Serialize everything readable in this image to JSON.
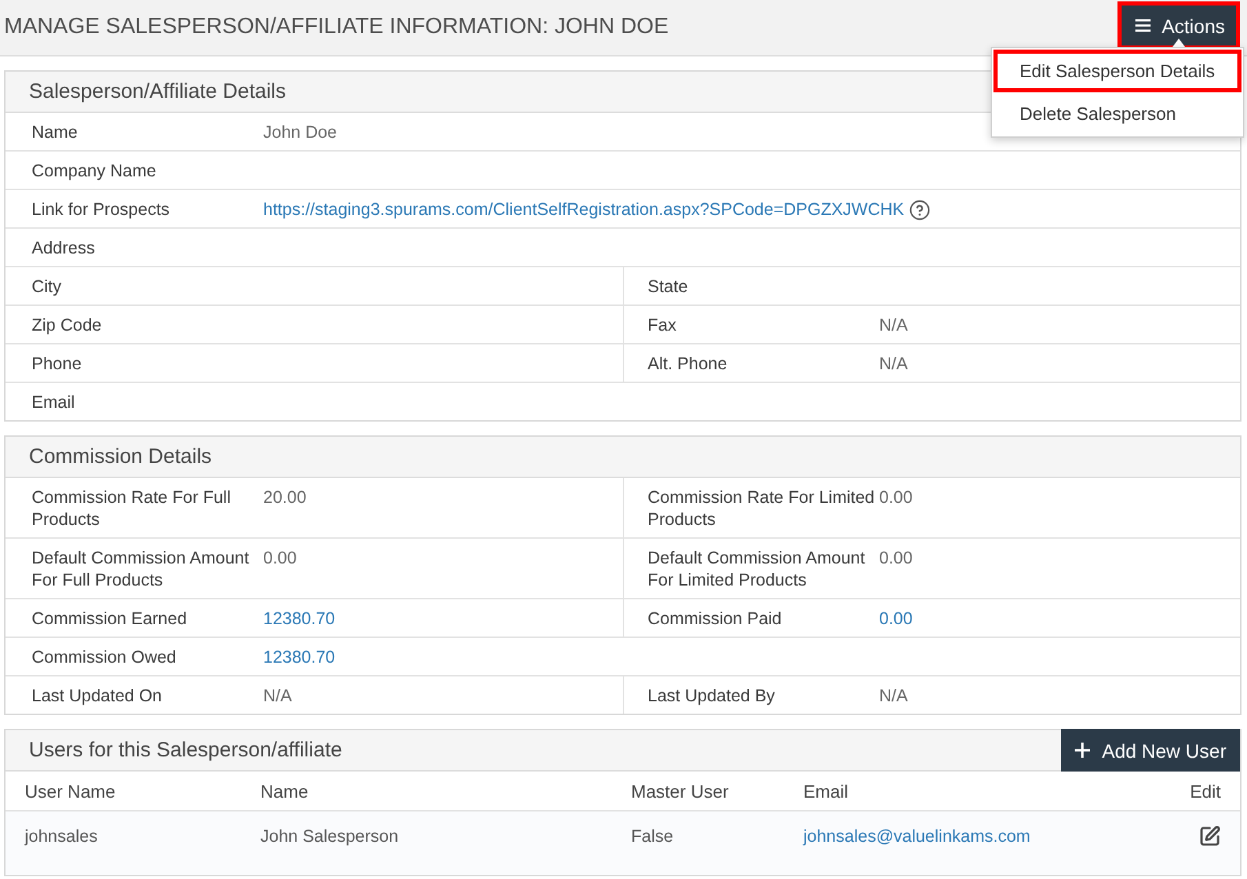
{
  "page": {
    "title": "MANAGE SALESPERSON/AFFILIATE INFORMATION: JOHN DOE"
  },
  "actions": {
    "label": "Actions",
    "highlighted": true,
    "expanded": true,
    "menu": [
      {
        "label": "Edit Salesperson Details",
        "highlighted": true
      },
      {
        "label": "Delete Salesperson",
        "highlighted": false
      }
    ]
  },
  "sections": [
    {
      "title": "Salesperson/Affiliate Details",
      "rows": [
        {
          "cells": [
            {
              "label": "Name",
              "value": "John Doe",
              "kind": "text"
            }
          ]
        },
        {
          "cells": [
            {
              "label": "Company Name"
            }
          ]
        },
        {
          "cells": [
            {
              "label": "Link for Prospects",
              "value": "https://staging3.spurams.com/ClientSelfRegistration.aspx?SPCode=DPGZXJWCHK",
              "kind": "link",
              "help": true
            }
          ]
        },
        {
          "cells": [
            {
              "label": "Address"
            }
          ]
        },
        {
          "cells": [
            {
              "label": "City"
            },
            {
              "label": "State"
            }
          ]
        },
        {
          "cells": [
            {
              "label": "Zip Code"
            },
            {
              "label": "Fax",
              "value": "N/A",
              "kind": "text"
            }
          ]
        },
        {
          "cells": [
            {
              "label": "Phone"
            },
            {
              "label": "Alt. Phone",
              "value": "N/A",
              "kind": "text"
            }
          ]
        },
        {
          "cells": [
            {
              "label": "Email"
            }
          ]
        }
      ]
    },
    {
      "title": "Commission Details",
      "rows": [
        {
          "cells": [
            {
              "label": "Commission Rate For Full Products",
              "value": "20.00",
              "kind": "text"
            },
            {
              "label": "Commission Rate For Limited Products",
              "value": "0.00",
              "kind": "text"
            }
          ]
        },
        {
          "cells": [
            {
              "label": "Default Commission Amount For Full Products",
              "value": "0.00",
              "kind": "text"
            },
            {
              "label": "Default Commission Amount For Limited Products",
              "value": "0.00",
              "kind": "text"
            }
          ]
        },
        {
          "cells": [
            {
              "label": "Commission Earned",
              "value": "12380.70",
              "kind": "link"
            },
            {
              "label": "Commission Paid",
              "value": "0.00",
              "kind": "link"
            }
          ]
        },
        {
          "cells": [
            {
              "label": "Commission Owed",
              "value": "12380.70",
              "kind": "link"
            }
          ]
        },
        {
          "cells": [
            {
              "label": "Last Updated On",
              "value": "N/A",
              "kind": "text"
            },
            {
              "label": "Last Updated By",
              "value": "N/A",
              "kind": "text"
            }
          ]
        }
      ]
    }
  ],
  "users": {
    "title": "Users for this Salesperson/affiliate",
    "add_button": {
      "label": "Add New User"
    },
    "columns": [
      "User Name",
      "Name",
      "Master User",
      "Email",
      "Edit"
    ],
    "rows": [
      {
        "cells": [
          {
            "kind": "text",
            "text": "johnsales"
          },
          {
            "kind": "text",
            "text": "John Salesperson"
          },
          {
            "kind": "text",
            "text": "False"
          },
          {
            "kind": "link",
            "text": "johnsales@valuelinkams.com"
          },
          {
            "kind": "edit"
          }
        ]
      }
    ]
  }
}
